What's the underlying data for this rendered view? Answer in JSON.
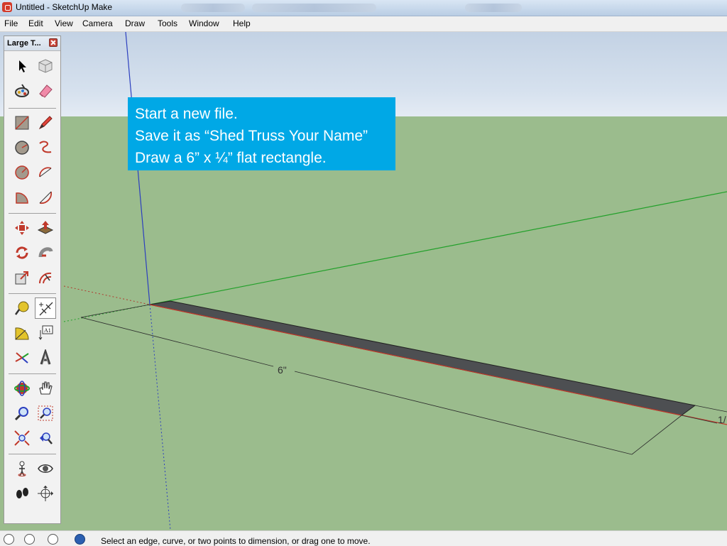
{
  "window": {
    "title": "Untitled - SketchUp Make"
  },
  "menu": [
    "File",
    "Edit",
    "View",
    "Camera",
    "Draw",
    "Tools",
    "Window",
    "Help"
  ],
  "toolbar": {
    "title": "Large T...",
    "tools": [
      "select-tool",
      "component-tool",
      "paint-bucket-tool",
      "eraser-tool",
      "rectangle-tool",
      "line-tool",
      "circle-tool",
      "freehand-tool",
      "polygon-tool",
      "arc-tool",
      "pie-tool",
      "two-point-arc-tool",
      "move-tool",
      "push-pull-tool",
      "rotate-tool",
      "follow-me-tool",
      "scale-tool",
      "offset-tool",
      "tape-measure-tool",
      "dimension-tool",
      "protractor-tool",
      "text-tool",
      "axes-tool",
      "3d-text-tool",
      "orbit-tool",
      "pan-tool",
      "zoom-tool",
      "zoom-window-tool",
      "zoom-extents-tool",
      "previous-view-tool",
      "position-camera-tool",
      "look-around-tool",
      "walk-tool",
      "section-plane-tool"
    ],
    "active_tool": "dimension-tool"
  },
  "callout": {
    "lines": [
      "Start a new file.",
      "Save it as “Shed Truss Your Name”",
      "Draw a 6” x ¼” flat rectangle."
    ]
  },
  "drawing": {
    "dimension_label": "6\"",
    "partial_dimension_label": "1/",
    "rectangle_color": "#4d4f52",
    "axis_colors": {
      "red": "#c0392b",
      "green": "#22a02a",
      "blue": "#2c3fbf"
    }
  },
  "status": {
    "message": "Select an edge, curve, or two points to dimension, or drag one to move."
  }
}
